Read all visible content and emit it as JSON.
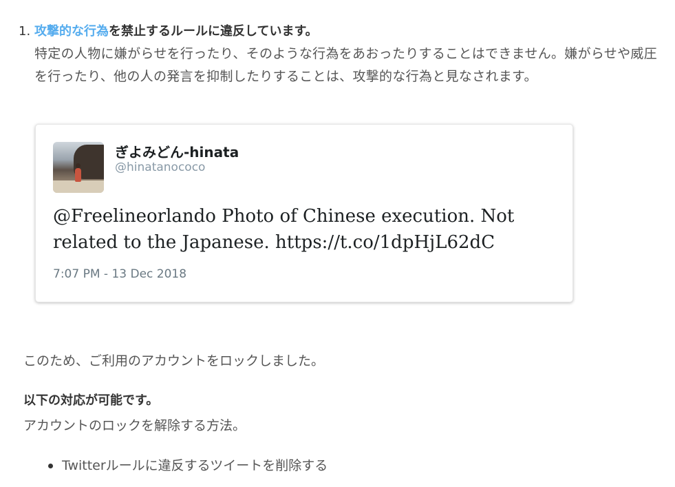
{
  "violation": {
    "number": "1.",
    "rule_link": "攻撃的な行為",
    "heading_rest": "を禁止するルールに違反しています。",
    "description": "特定の人物に嫌がらせを行ったり、そのような行為をあおったりすることはできません。嫌がらせや威圧を行ったり、他の人の発言を抑制したりすることは、攻撃的な行為と見なされます。"
  },
  "tweet": {
    "display_name": "ぎよみどん-hinata",
    "handle": "@hinatanococo",
    "text": "@Freelineorlando Photo of Chinese execution. Not related to the Japanese. https://t.co/1dpHjL62dC",
    "timestamp": "7:07 PM - 13 Dec 2018",
    "avatar_icon": "profile-photo"
  },
  "account": {
    "locked_message": "このため、ご利用のアカウントをロックしました。",
    "options_heading": "以下の対応が可能です。",
    "options_subtitle": "アカウントのロックを解除する方法。",
    "options": [
      "Twitterルールに違反するツイートを削除する"
    ]
  },
  "colors": {
    "link": "#55acee",
    "text": "#333333",
    "muted": "#8899a6"
  }
}
